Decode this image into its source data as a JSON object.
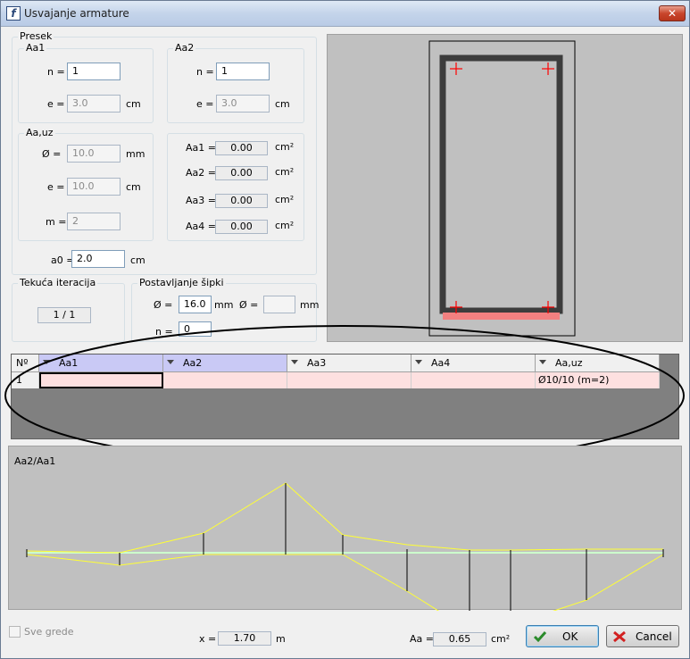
{
  "window": {
    "title": "Usvajanje armature",
    "icon": "app-icon",
    "close": "✕"
  },
  "presek": {
    "title": "Presek",
    "aa1": {
      "title": "Aa1",
      "n_label": "n =",
      "n_value": "1",
      "e_label": "e =",
      "e_value": "3.0",
      "e_unit": "cm"
    },
    "aa2": {
      "title": "Aa2",
      "n_label": "n =",
      "n_value": "1",
      "e_label": "e =",
      "e_value": "3.0",
      "e_unit": "cm"
    },
    "aauz": {
      "title": "Aa,uz",
      "d_label": "Ø =",
      "d_value": "10.0",
      "d_unit": "mm",
      "e_label": "e =",
      "e_value": "10.0",
      "e_unit": "cm",
      "m_label": "m =",
      "m_value": "2"
    },
    "areas": [
      {
        "label": "Aa1 =",
        "value": "0.00",
        "unit": "cm²"
      },
      {
        "label": "Aa2 =",
        "value": "0.00",
        "unit": "cm²"
      },
      {
        "label": "Aa3 =",
        "value": "0.00",
        "unit": "cm²"
      },
      {
        "label": "Aa4 =",
        "value": "0.00",
        "unit": "cm²"
      }
    ],
    "a0_label": "a0 =",
    "a0_value": "2.0",
    "a0_unit": "cm"
  },
  "iteracija": {
    "title": "Tekuća iteracija",
    "value": "1 / 1"
  },
  "postavljanje": {
    "title": "Postavljanje šipki",
    "d1_label": "Ø =",
    "d1_value": "16.0",
    "d1_unit": "mm",
    "d2_label": "Ø =",
    "d2_value": "",
    "d2_unit": "mm",
    "n_label": "n =",
    "n_value": "0"
  },
  "grid": {
    "columns": [
      "Nº",
      "Aa1",
      "Aa2",
      "Aa3",
      "Aa4",
      "Aa,uz"
    ],
    "rows": [
      {
        "no": "1",
        "aa1": "",
        "aa2": "",
        "aa3": "",
        "aa4": "",
        "aauz": "Ø10/10 (m=2)"
      }
    ]
  },
  "diagram": {
    "label": "Aa2/Aa1"
  },
  "bottom": {
    "sve_grede": "Sve grede",
    "x_label": "x =",
    "x_value": "1.70",
    "x_unit": "m",
    "aa_label": "Aa =",
    "aa_value": "0.65",
    "aa_unit": "cm²",
    "ok": "OK",
    "cancel": "Cancel"
  },
  "colors": {
    "rebar_marker": "#ff0000",
    "bottom_bar": "#f28080",
    "diagram_line": "#ffff33",
    "axis_line": "#ccffcc",
    "selected_header": "#c9c9f5",
    "row_fill": "#fde0e0"
  },
  "icons": {
    "ok": "check-icon",
    "cancel": "cross-icon",
    "sort": "sort-arrow-icon"
  }
}
